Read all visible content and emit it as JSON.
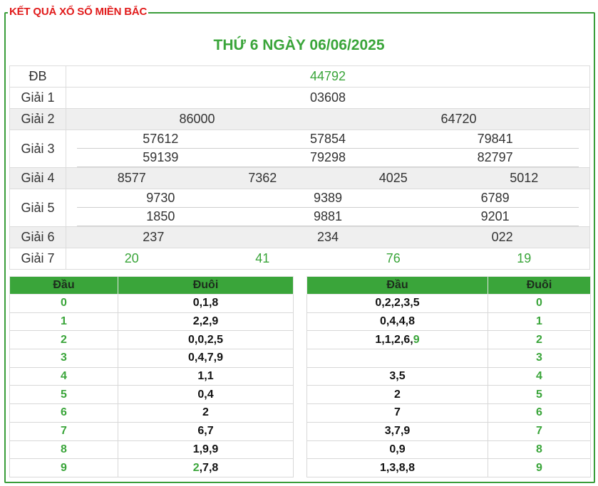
{
  "header": {
    "title": "KẾT QUẢ XỔ SỐ MIỀN BẮC"
  },
  "draw": {
    "date_title": "THỨ 6 NGÀY 06/06/2025"
  },
  "prizes": {
    "db": {
      "label": "ĐB",
      "values": [
        "44792"
      ]
    },
    "g1": {
      "label": "Giải 1",
      "values": [
        "03608"
      ]
    },
    "g2": {
      "label": "Giải 2",
      "values": [
        "86000",
        "64720"
      ]
    },
    "g3": {
      "label": "Giải 3",
      "values": [
        "57612",
        "57854",
        "79841",
        "59139",
        "79298",
        "82797"
      ]
    },
    "g4": {
      "label": "Giải 4",
      "values": [
        "8577",
        "7362",
        "4025",
        "5012"
      ]
    },
    "g5": {
      "label": "Giải 5",
      "values": [
        "9730",
        "9389",
        "6789",
        "1850",
        "9881",
        "9201"
      ]
    },
    "g6": {
      "label": "Giải 6",
      "values": [
        "237",
        "234",
        "022"
      ]
    },
    "g7": {
      "label": "Giải 7",
      "values": [
        "20",
        "41",
        "76",
        "19"
      ]
    }
  },
  "loto_head": {
    "headers": {
      "dau": "Đầu",
      "duoi": "Đuôi"
    },
    "rows": [
      {
        "head": "0",
        "tail": "0,1,8"
      },
      {
        "head": "1",
        "tail": "2,2,9"
      },
      {
        "head": "2",
        "tail": "0,0,2,5"
      },
      {
        "head": "3",
        "tail": "0,4,7,9"
      },
      {
        "head": "4",
        "tail": "1,1"
      },
      {
        "head": "5",
        "tail": "0,4"
      },
      {
        "head": "6",
        "tail": "2"
      },
      {
        "head": "7",
        "tail": "6,7"
      },
      {
        "head": "8",
        "tail": "1,9,9"
      },
      {
        "head": "9",
        "tail_pre": "2",
        "tail": ",7,8"
      }
    ]
  },
  "loto_tail": {
    "headers": {
      "dau": "Đầu",
      "duoi": "Đuôi"
    },
    "rows": [
      {
        "heads": "0,2,2,3,5",
        "tail": "0"
      },
      {
        "heads": "0,4,4,8",
        "tail": "1"
      },
      {
        "heads": "1,1,2,6,",
        "heads_post": "9",
        "tail": "2"
      },
      {
        "heads": "",
        "tail": "3"
      },
      {
        "heads": "3,5",
        "tail": "4"
      },
      {
        "heads": "2",
        "tail": "5"
      },
      {
        "heads": "7",
        "tail": "6"
      },
      {
        "heads": "3,7,9",
        "tail": "7"
      },
      {
        "heads": "0,9",
        "tail": "8"
      },
      {
        "heads": "1,3,8,8",
        "tail": "9"
      }
    ]
  },
  "colors": {
    "accent_green": "#3aa53a",
    "title_red": "#e11b1b",
    "row_gray": "#efefef"
  }
}
